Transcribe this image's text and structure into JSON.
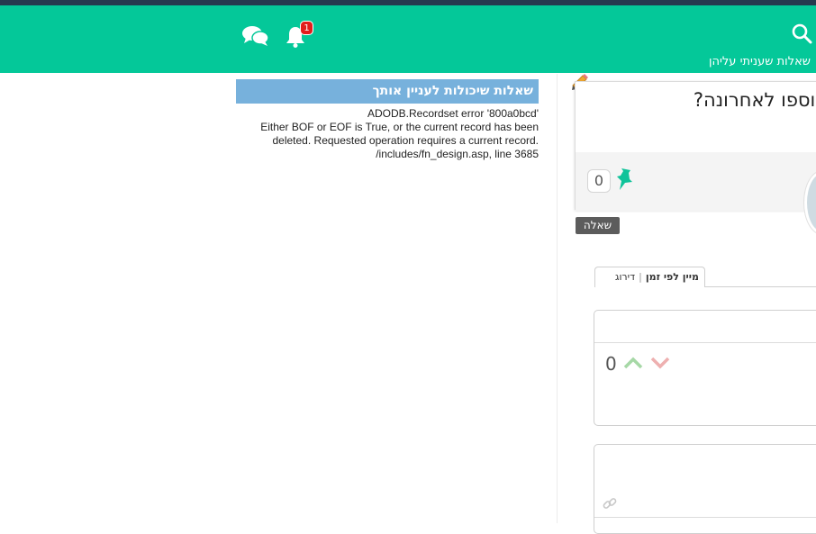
{
  "header": {
    "my_answers_link": "שאלות שעניתי עליהן",
    "notifications_count": "1",
    "colors": {
      "bar": "#04c899",
      "top_strip": "#263a4f"
    }
  },
  "widget": {
    "title": "שאלות שיכולות לעניין אותך",
    "error_lines": [
      "ADODB.Recordset error '800a0bcd'",
      "Either BOF or EOF is True, or the current record has been",
      "deleted. Requested operation requires a current record.",
      "/includes/fn_design.asp, line 3685"
    ]
  },
  "question": {
    "title": "הוספו לאחרונה?",
    "vote_count": "0",
    "type_badge": "שאלה"
  },
  "sort_tabs": {
    "by_time": "מיין לפי זמן",
    "by_rank": "דירוג"
  },
  "answer": {
    "vote_count": "0"
  }
}
